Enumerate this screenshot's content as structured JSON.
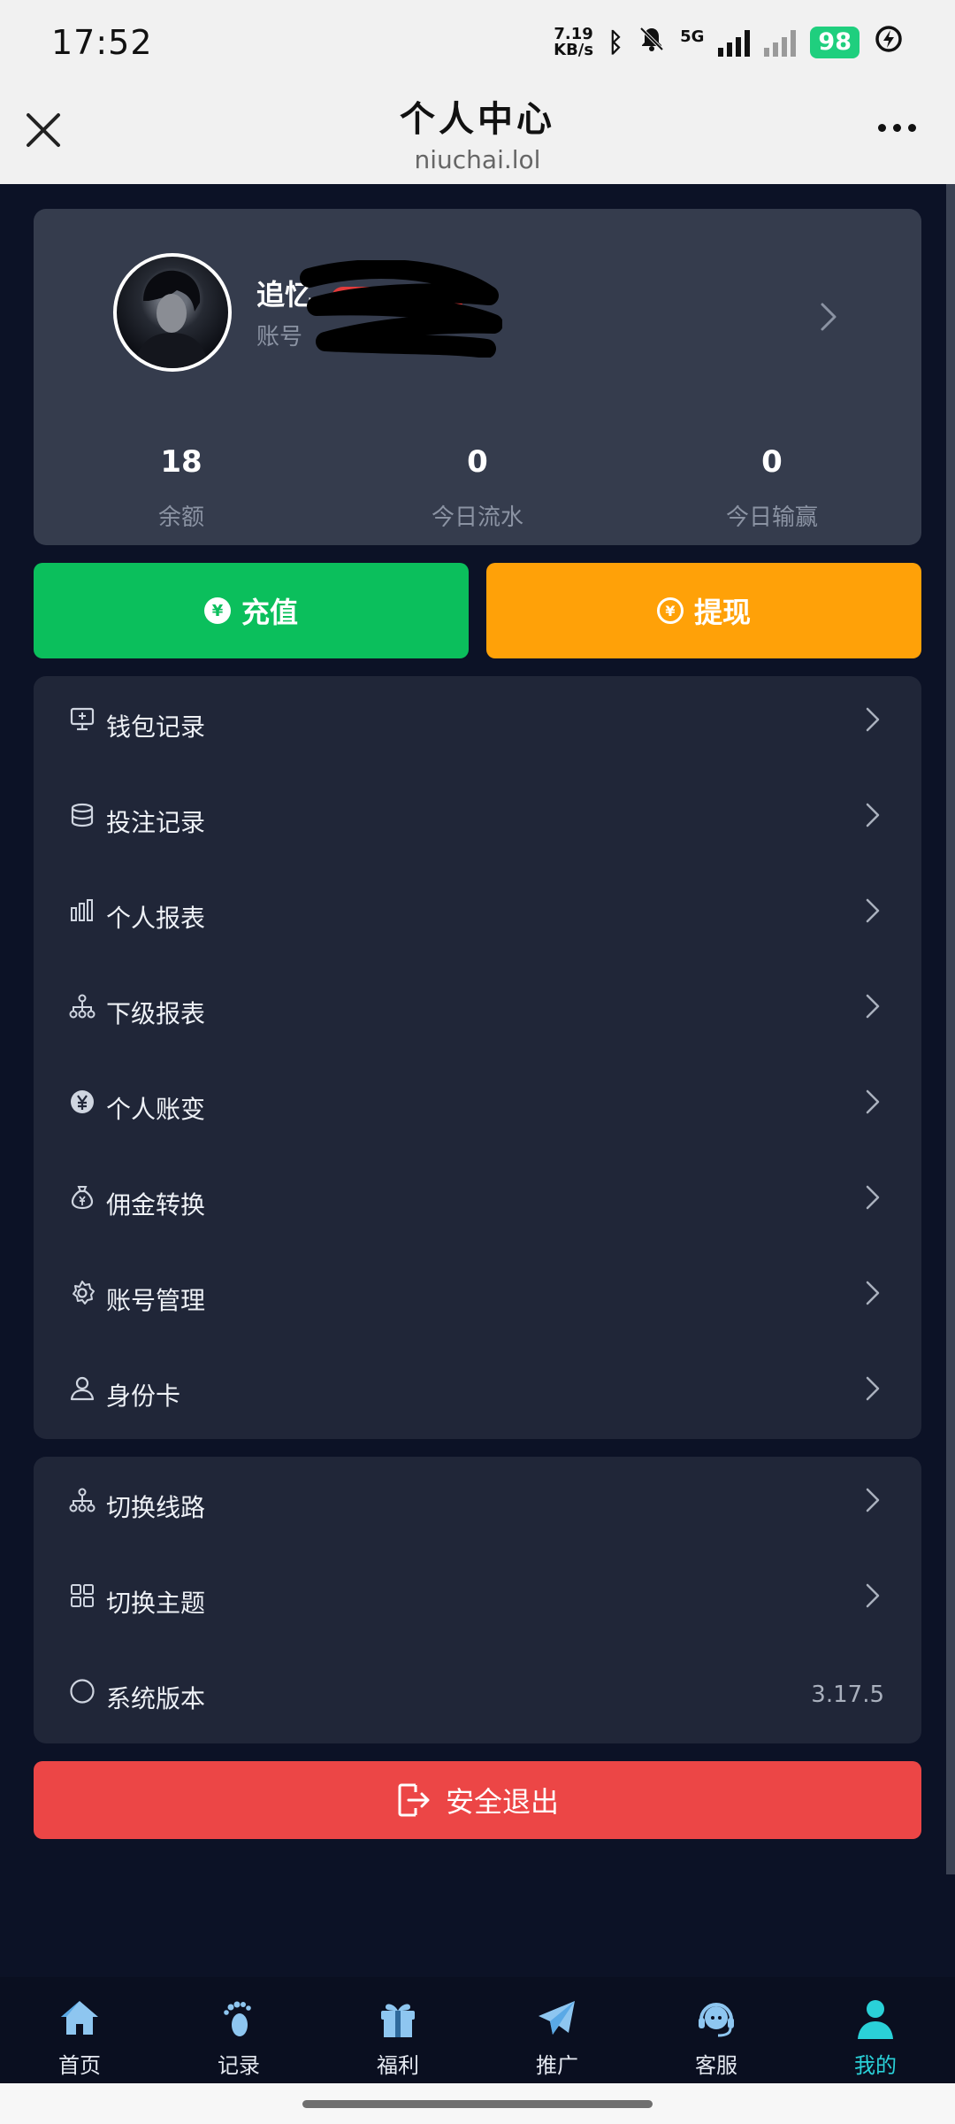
{
  "status_bar": {
    "time": "17:52",
    "net_speed_top": "7.19",
    "net_speed_bottom": "KB/s",
    "bluetooth_icon": "ᛒ",
    "mute_icon": "🔕",
    "network": "5G",
    "battery": "98",
    "charging_icon": "⚡"
  },
  "title_bar": {
    "title": "个人中心",
    "subtitle": "niuchai.lol"
  },
  "profile": {
    "name": "追忆",
    "account_prefix": "账号",
    "stats": [
      {
        "value": "18",
        "label": "余额"
      },
      {
        "value": "0",
        "label": "今日流水"
      },
      {
        "value": "0",
        "label": "今日输赢"
      }
    ]
  },
  "actions": {
    "recharge": "充值",
    "withdraw": "提现",
    "coin_symbol": "¥"
  },
  "menu_primary": [
    {
      "label": "钱包记录",
      "icon": "monitor-icon"
    },
    {
      "label": "投注记录",
      "icon": "database-icon"
    },
    {
      "label": "个人报表",
      "icon": "bar-chart-icon"
    },
    {
      "label": "下级报表",
      "icon": "hierarchy-icon"
    },
    {
      "label": "个人账变",
      "icon": "yen-coin-icon"
    },
    {
      "label": "佣金转换",
      "icon": "money-bag-icon"
    },
    {
      "label": "账号管理",
      "icon": "gear-icon"
    },
    {
      "label": "身份卡",
      "icon": "user-icon"
    }
  ],
  "menu_secondary": [
    {
      "label": "切换线路",
      "icon": "hierarchy-icon"
    },
    {
      "label": "切换主题",
      "icon": "grid-icon"
    },
    {
      "label": "系统版本",
      "icon": "circle-icon",
      "value": "3.17.5"
    }
  ],
  "logout": {
    "label": "安全退出"
  },
  "tabs": [
    {
      "label": "首页",
      "icon": "home-icon",
      "active": false
    },
    {
      "label": "记录",
      "icon": "footprint-icon",
      "active": false
    },
    {
      "label": "福利",
      "icon": "gift-icon",
      "active": false
    },
    {
      "label": "推广",
      "icon": "paper-plane-icon",
      "active": false
    },
    {
      "label": "客服",
      "icon": "headset-icon",
      "active": false
    },
    {
      "label": "我的",
      "icon": "person-icon",
      "active": true
    }
  ],
  "colors": {
    "background": "#0c1226",
    "card": "#202638",
    "profile_card": "#353c4d",
    "recharge": "#0bbf5c",
    "withdraw": "#ffa108",
    "logout": "#ec4646",
    "active_tab": "#2ad1d8"
  }
}
